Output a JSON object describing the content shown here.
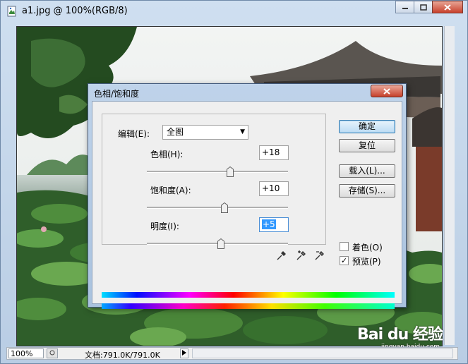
{
  "window": {
    "title": "a1.jpg @ 100%(RGB/8)"
  },
  "status": {
    "zoom": "100%",
    "doc_info": "文档:791.0K/791.0K"
  },
  "watermark": {
    "brand": "Bai du 经验",
    "sub": "jingyan.baidu.com"
  },
  "dialog": {
    "title": "色相/饱和度",
    "edit_label": "编辑(E):",
    "edit_value": "全图",
    "hue_label": "色相(H):",
    "hue_value": "+18",
    "sat_label": "饱和度(A):",
    "sat_value": "+10",
    "light_label": "明度(I):",
    "light_value": "+5",
    "ok": "确定",
    "reset": "复位",
    "load": "载入(L)...",
    "save": "存储(S)...",
    "colorize_label": "着色(O)",
    "colorize_checked": false,
    "preview_label": "预览(P)",
    "preview_checked": true
  }
}
